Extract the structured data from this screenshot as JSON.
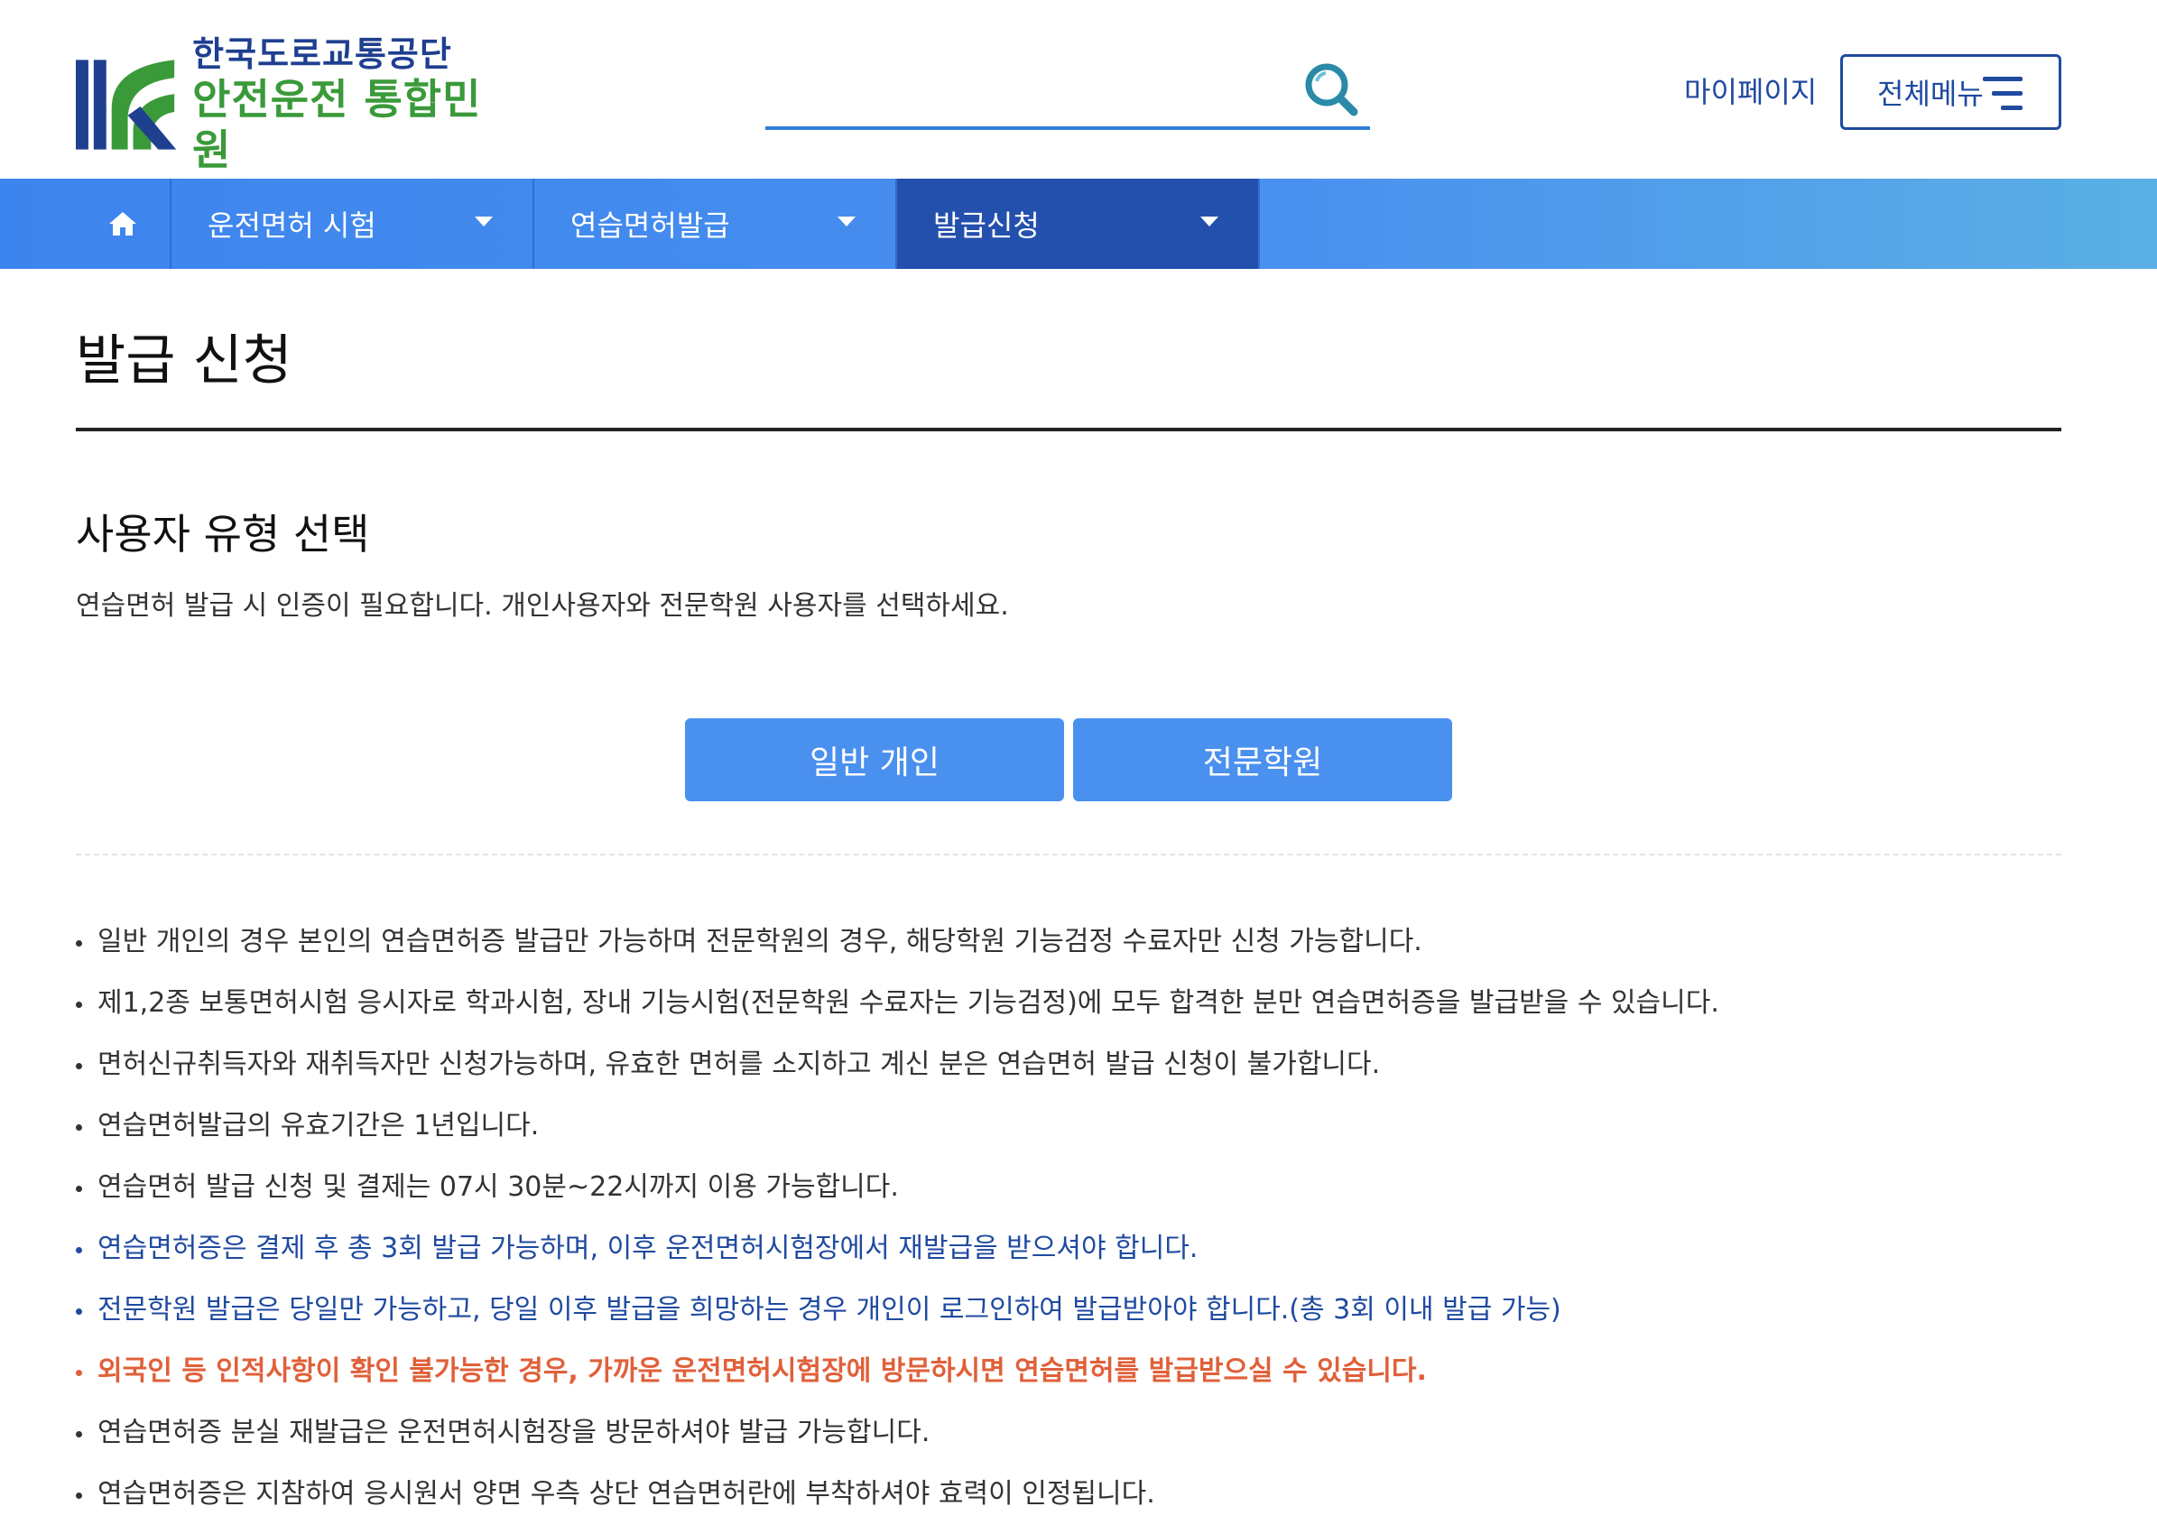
{
  "header": {
    "logo_line1": "한국도로교통공단",
    "logo_line2": "안전운전 통합민원",
    "search_placeholder": "",
    "mypage_label": "마이페이지",
    "menu_label": "전체메뉴"
  },
  "nav": {
    "items": [
      {
        "label": "운전면허 시험"
      },
      {
        "label": "연습면허발급"
      },
      {
        "label": "발급신청"
      }
    ]
  },
  "page": {
    "title": "발급 신청",
    "section_title": "사용자 유형 선택",
    "section_desc": "연습면허 발급 시 인증이 필요합니다. 개인사용자와 전문학원 사용자를 선택하세요.",
    "buttons": {
      "personal": "일반 개인",
      "academy": "전문학원"
    },
    "notes": [
      "일반 개인의 경우 본인의 연습면허증 발급만 가능하며 전문학원의 경우, 해당학원 기능검정 수료자만 신청 가능합니다.",
      "제1,2종 보통면허시험 응시자로 학과시험, 장내 기능시험(전문학원 수료자는 기능검정)에 모두 합격한 분만 연습면허증을 발급받을 수 있습니다.",
      "면허신규취득자와 재취득자만 신청가능하며, 유효한 면허를 소지하고 계신 분은 연습면허 발급 신청이 불가합니다.",
      "연습면허발급의 유효기간은 1년입니다.",
      "연습면허 발급 신청 및 결제는 07시 30분~22시까지 이용 가능합니다.",
      "연습면허증은 결제 후 총 3회 발급 가능하며, 이후 운전면허시험장에서 재발급을 받으셔야 합니다.",
      "전문학원 발급은 당일만 가능하고, 당일 이후 발급을 희망하는 경우 개인이 로그인하여 발급받아야 합니다.(총 3회 이내 발급 가능)",
      "외국인 등 인적사항이 확인 불가능한 경우, 가까운 운전면허시험장에 방문하시면 연습면허를 발급받으실 수 있습니다.",
      "연습면허증 분실 재발급은 운전면허시험장을 방문하셔야 발급 가능합니다.",
      "연습면허증은 지참하여 응시원서 양면 우측 상단 연습면허란에 부착하셔야 효력이 인정됩니다."
    ]
  },
  "colors": {
    "primary_blue": "#4a90ef",
    "nav_active": "#2450ad",
    "navy": "#1f4aa0",
    "logo_green": "#3a9a3a",
    "warning_red": "#e0603a"
  },
  "icons": {
    "logo": "kora-logo-icon",
    "search": "search-icon",
    "home": "home-icon",
    "menu": "hamburger-icon",
    "dropdown": "caret-down-icon"
  }
}
